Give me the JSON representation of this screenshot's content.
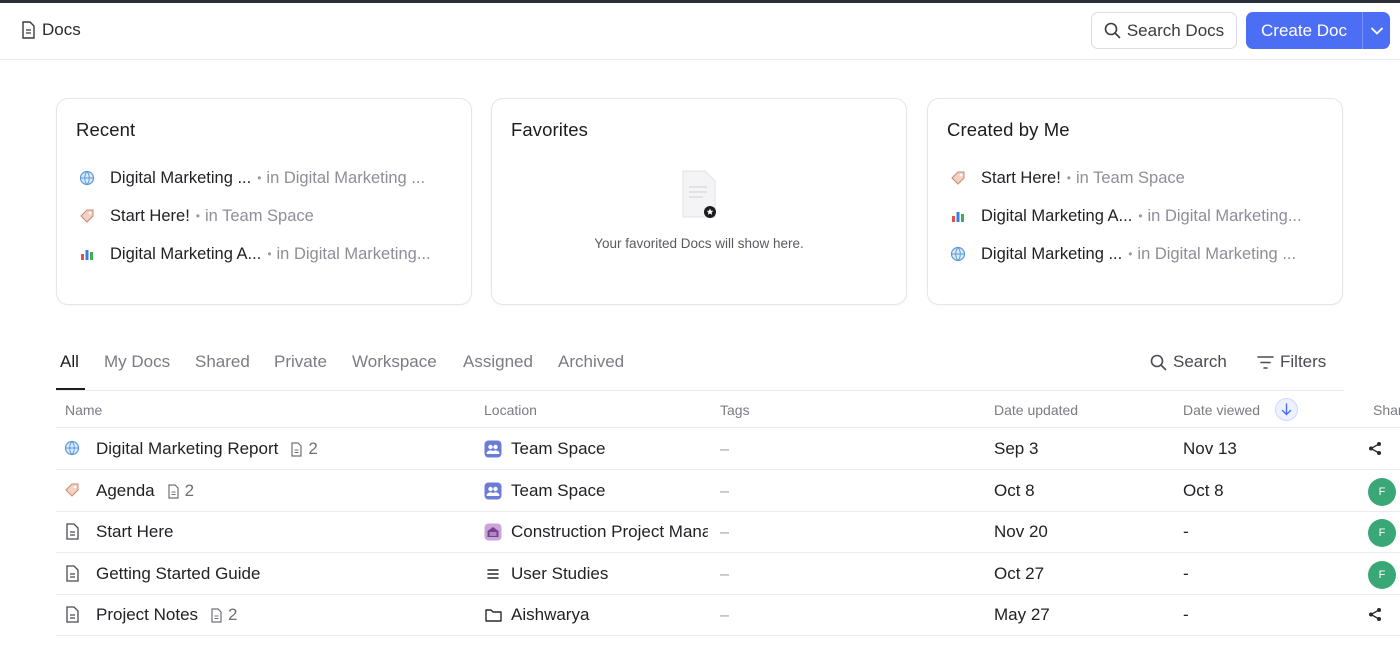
{
  "header": {
    "title": "Docs",
    "search_label": "Search Docs",
    "create_label": "Create Doc"
  },
  "cards": {
    "recent": {
      "title": "Recent",
      "items": [
        {
          "icon": "globe-icon",
          "name": "Digital Marketing ...",
          "location": "in Digital Marketing ..."
        },
        {
          "icon": "tag-icon",
          "name": "Start Here!",
          "location": "in Team Space"
        },
        {
          "icon": "bar-chart-icon",
          "name": "Digital Marketing A...",
          "location": "in Digital Marketing..."
        }
      ]
    },
    "favorites": {
      "title": "Favorites",
      "empty_text": "Your favorited Docs will show here."
    },
    "created": {
      "title": "Created by Me",
      "items": [
        {
          "icon": "tag-icon",
          "name": "Start Here!",
          "location": "in Team Space"
        },
        {
          "icon": "bar-chart-icon",
          "name": "Digital Marketing A...",
          "location": "in Digital Marketing..."
        },
        {
          "icon": "globe-icon",
          "name": "Digital Marketing ...",
          "location": "in Digital Marketing ..."
        }
      ]
    }
  },
  "tabs": [
    "All",
    "My Docs",
    "Shared",
    "Private",
    "Workspace",
    "Assigned",
    "Archived"
  ],
  "active_tab": "All",
  "tools": {
    "search": "Search",
    "filters": "Filters"
  },
  "columns": {
    "name": "Name",
    "location": "Location",
    "tags": "Tags",
    "date_updated": "Date updated",
    "date_viewed": "Date viewed",
    "sharing": "Shar"
  },
  "rows": [
    {
      "icon": "globe-icon",
      "name": "Digital Marketing Report",
      "subpages": "2",
      "location_icon": "team-space-icon",
      "location": "Team Space",
      "tags": "–",
      "date_updated": "Sep 3",
      "date_viewed": "Nov 13",
      "share": "share-icon"
    },
    {
      "icon": "tag-icon",
      "name": "Agenda",
      "subpages": "2",
      "location_icon": "team-space-icon",
      "location": "Team Space",
      "tags": "–",
      "date_updated": "Oct 8",
      "date_viewed": "Oct 8",
      "share": "avatar",
      "avatar_initial": "F"
    },
    {
      "icon": "doc-icon",
      "name": "Start Here",
      "subpages": "",
      "location_icon": "folder-building-icon",
      "location": "Construction Project Mana",
      "tags": "–",
      "date_updated": "Nov 20",
      "date_viewed": "-",
      "share": "avatar",
      "avatar_initial": "F"
    },
    {
      "icon": "doc-icon",
      "name": "Getting Started Guide",
      "subpages": "",
      "location_icon": "list-icon",
      "location": "User Studies",
      "tags": "–",
      "date_updated": "Oct 27",
      "date_viewed": "-",
      "share": "avatar",
      "avatar_initial": "F"
    },
    {
      "icon": "doc-icon",
      "name": "Project Notes",
      "subpages": "2",
      "location_icon": "folder-icon",
      "location": "Aishwarya",
      "tags": "–",
      "date_updated": "May 27",
      "date_viewed": "-",
      "share": "share-icon"
    }
  ],
  "colors": {
    "accent": "#4c6ef5",
    "avatar": "#3aa876"
  }
}
